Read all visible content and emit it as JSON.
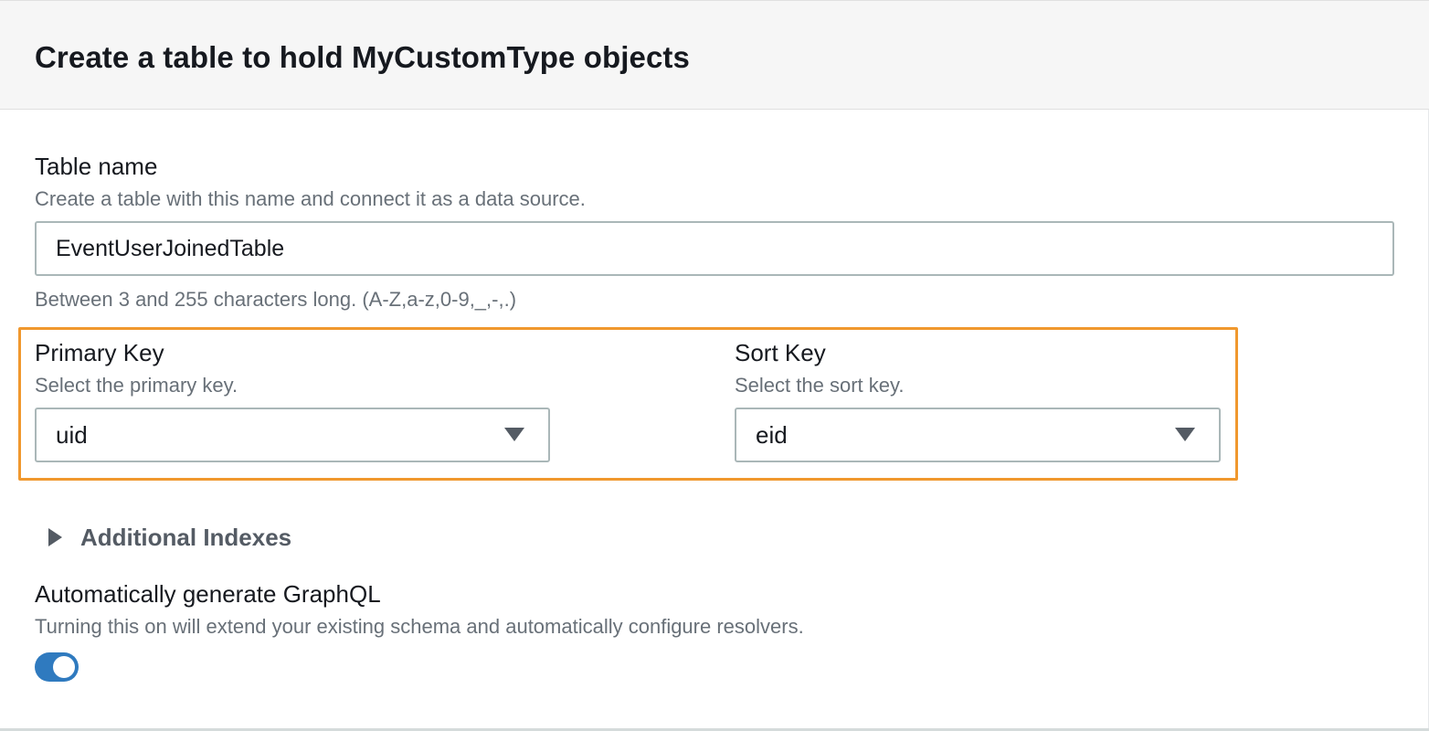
{
  "header": {
    "title": "Create a table to hold MyCustomType objects"
  },
  "table_name": {
    "label": "Table name",
    "description": "Create a table with this name and connect it as a data source.",
    "value": "EventUserJoinedTable",
    "constraint": "Between 3 and 255 characters long. (A-Z,a-z,0-9,_,-,.)"
  },
  "primary_key": {
    "label": "Primary Key",
    "description": "Select the primary key.",
    "selected": "uid"
  },
  "sort_key": {
    "label": "Sort Key",
    "description": "Select the sort key.",
    "selected": "eid"
  },
  "additional_indexes": {
    "label": "Additional Indexes",
    "expanded": false
  },
  "graphql": {
    "label": "Automatically generate GraphQL",
    "description": "Turning this on will extend your existing schema and automatically configure resolvers.",
    "enabled": true
  },
  "colors": {
    "highlight": "#f0982e",
    "toggle_on": "#2f7abf",
    "secondary_text": "#687078"
  }
}
